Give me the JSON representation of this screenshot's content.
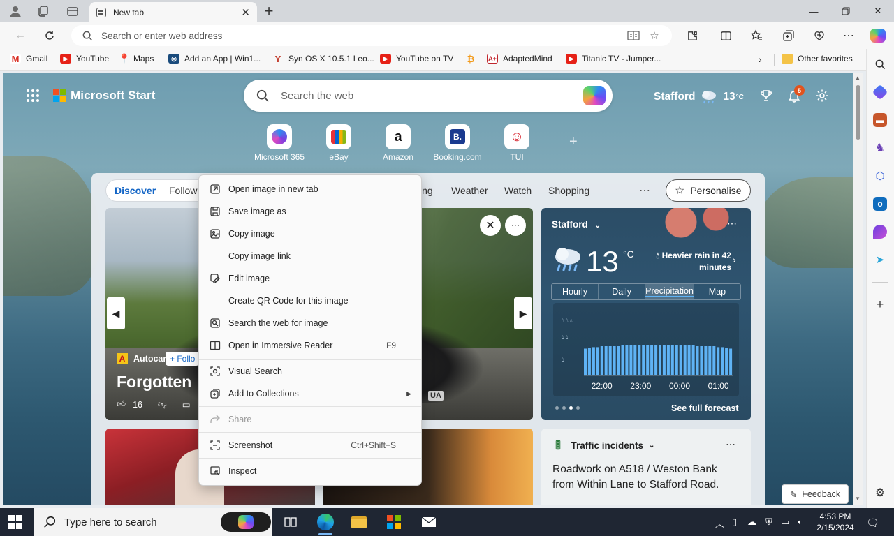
{
  "browser": {
    "tab_title": "New tab",
    "address_placeholder": "Search or enter web address"
  },
  "favorites": [
    {
      "label": "Gmail",
      "icon": "gmail-icon",
      "color": "#d93025"
    },
    {
      "label": "YouTube",
      "icon": "youtube-icon",
      "color": "#e62117"
    },
    {
      "label": "Maps",
      "icon": "maps-icon",
      "color": "#34a853"
    },
    {
      "label": "Add an App | Win1...",
      "icon": "app-icon",
      "color": "#1a4b7c"
    },
    {
      "label": "Syn OS X 10.5.1 Leo...",
      "icon": "syn-icon",
      "color": "#c23a2a"
    },
    {
      "label": "YouTube on TV",
      "icon": "youtube-icon",
      "color": "#e62117"
    },
    {
      "label": "",
      "icon": "bitcoin-icon",
      "color": "#f29a1a"
    },
    {
      "label": "AdaptedMind",
      "icon": "adaptedmind-icon",
      "color": "#c0262d"
    },
    {
      "label": "Titanic TV - Jumper...",
      "icon": "youtube-icon",
      "color": "#e62117"
    }
  ],
  "other_favorites": "Other favorites",
  "start_page": {
    "brand": "Microsoft Start",
    "search_placeholder": "Search the web",
    "location": "Stafford",
    "temperature": "13",
    "temp_unit": "°C",
    "notification_count": "5",
    "quick_links": [
      {
        "label": "Microsoft 365",
        "glyph": "◉",
        "color": "#7a3fe0"
      },
      {
        "label": "eBay",
        "glyph": "ebay",
        "color": "#e53238"
      },
      {
        "label": "Amazon",
        "glyph": "a",
        "color": "#111111"
      },
      {
        "label": "Booking.com",
        "glyph": "B.",
        "color": "#1a3a8f"
      },
      {
        "label": "TUI",
        "glyph": "☺",
        "color": "#d6202a"
      }
    ]
  },
  "feed_nav": {
    "items": [
      "Discover",
      "Followi",
      "ing",
      "Weather",
      "Watch",
      "Shopping"
    ],
    "active": "Discover",
    "personalise": "Personalise"
  },
  "hero": {
    "source": "Autocar",
    "follow": "+ Follo",
    "title": "Forgotten",
    "likes": "16",
    "plate": "UA"
  },
  "weather_card": {
    "location": "Stafford",
    "temperature": "13",
    "unit": "°C",
    "alert": "Heavier rain in 42 minutes",
    "tabs": [
      "Hourly",
      "Daily",
      "Precipitation",
      "Map"
    ],
    "selected_tab": "Precipitation",
    "footer": "See full forecast"
  },
  "chart_data": {
    "type": "bar",
    "xtick_labels": [
      "22:00",
      "23:00",
      "00:00",
      "01:00"
    ],
    "values": [
      0.55,
      0.57,
      0.58,
      0.58,
      0.6,
      0.6,
      0.6,
      0.6,
      0.6,
      0.62,
      0.62,
      0.62,
      0.62,
      0.62,
      0.62,
      0.62,
      0.62,
      0.62,
      0.62,
      0.62,
      0.62,
      0.62,
      0.62,
      0.62,
      0.62,
      0.62,
      0.62,
      0.6,
      0.6,
      0.6,
      0.6,
      0.6,
      0.58,
      0.58,
      0.57,
      0.55
    ],
    "ylim": [
      0,
      1
    ],
    "intensity_levels": [
      "heavy",
      "moderate",
      "light"
    ],
    "bar_color": "#5fb3f5"
  },
  "traffic_card": {
    "header": "Traffic incidents",
    "body": "Roadwork on A518 / Weston Bank from Within Lane to Stafford Road."
  },
  "feedback_label": "Feedback",
  "context_menu": [
    {
      "label": "Open image in new tab",
      "shortcut": "",
      "icon": "open-new-tab-icon",
      "disabled": false
    },
    {
      "label": "Save image as",
      "shortcut": "",
      "icon": "save-icon",
      "disabled": false
    },
    {
      "label": "Copy image",
      "shortcut": "",
      "icon": "copy-image-icon",
      "disabled": false
    },
    {
      "label": "Copy image link",
      "shortcut": "",
      "icon": "",
      "disabled": false
    },
    {
      "label": "Edit image",
      "shortcut": "",
      "icon": "edit-image-icon",
      "disabled": false
    },
    {
      "label": "Create QR Code for this image",
      "shortcut": "",
      "icon": "",
      "disabled": false
    },
    {
      "label": "Search the web for image",
      "shortcut": "",
      "icon": "search-web-icon",
      "disabled": false
    },
    {
      "label": "Open in Immersive Reader",
      "shortcut": "F9",
      "icon": "immersive-reader-icon",
      "disabled": false
    },
    {
      "label": "Visual Search",
      "shortcut": "",
      "icon": "visual-search-icon",
      "disabled": false
    },
    {
      "label": "Add to Collections",
      "shortcut": "",
      "icon": "collections-icon",
      "disabled": false
    },
    {
      "label": "Share",
      "shortcut": "",
      "icon": "share-icon",
      "disabled": true
    },
    {
      "label": "Screenshot",
      "shortcut": "Ctrl+Shift+S",
      "icon": "screenshot-icon",
      "disabled": false
    },
    {
      "label": "Inspect",
      "shortcut": "",
      "icon": "inspect-icon",
      "disabled": false
    }
  ],
  "taskbar": {
    "search_placeholder": "Type here to search",
    "time": "4:53 PM",
    "date": "2/15/2024"
  }
}
